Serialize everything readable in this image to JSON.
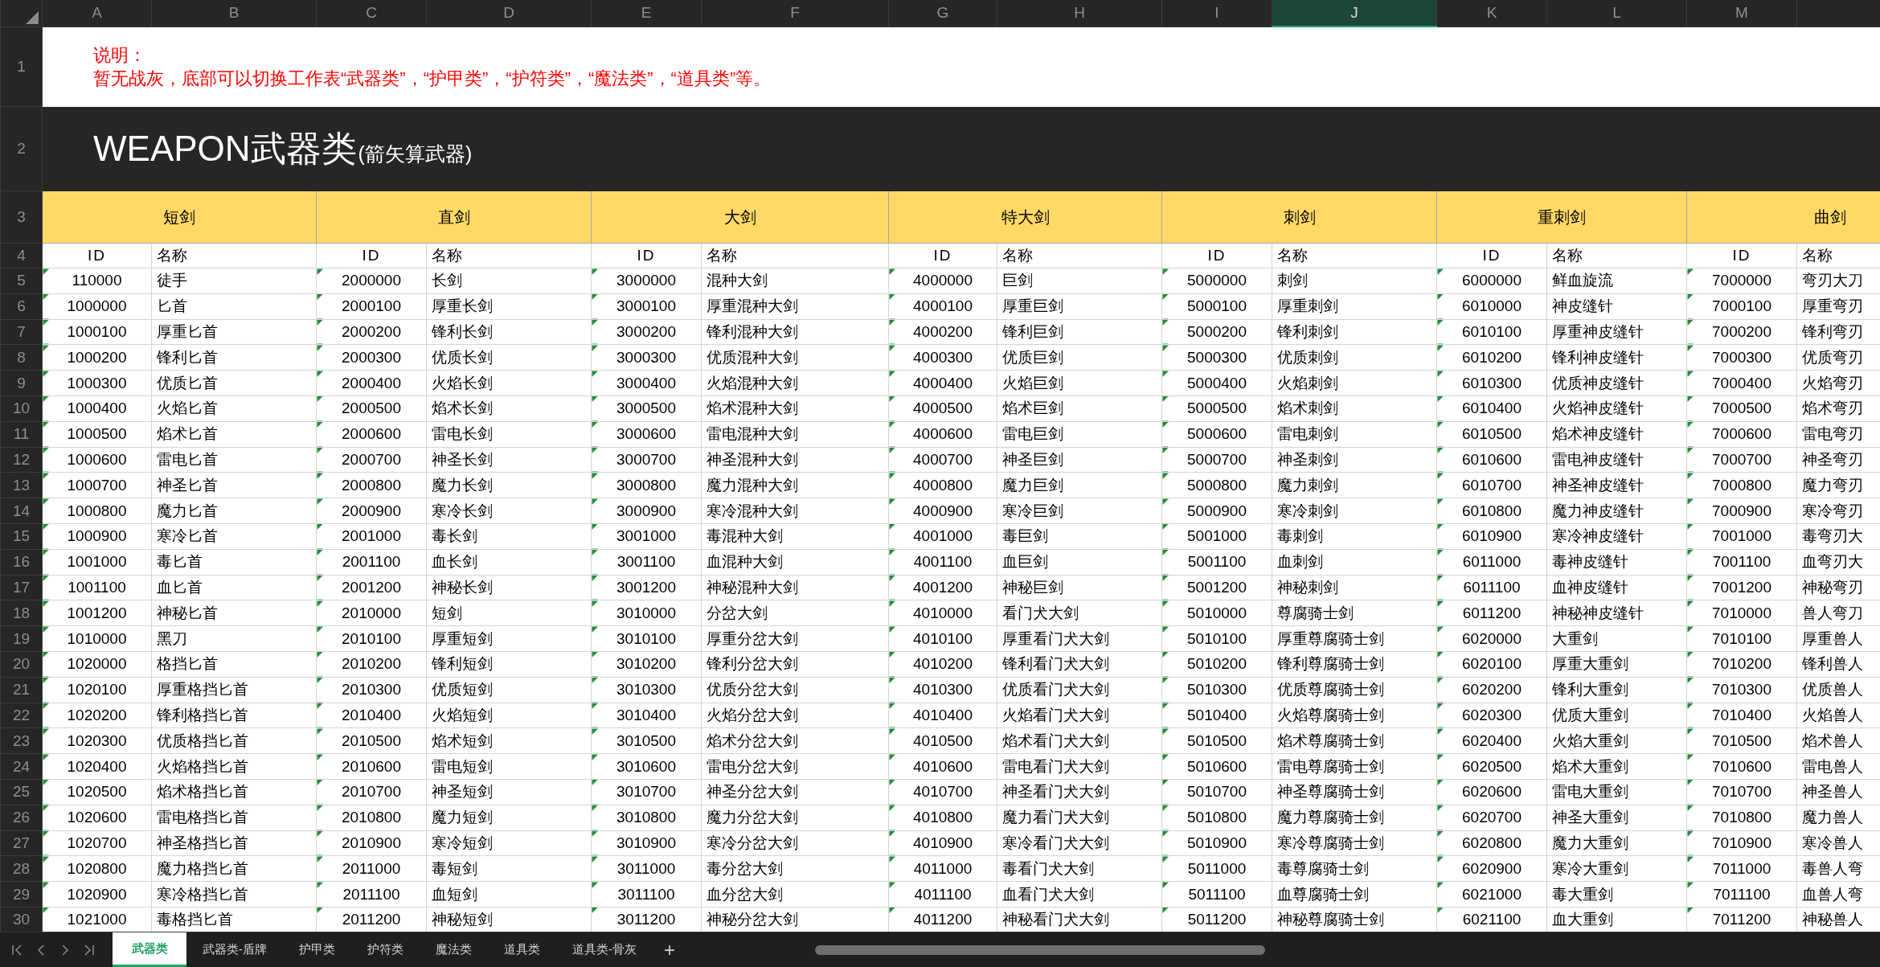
{
  "column_headers": [
    {
      "label": "A",
      "selected": false
    },
    {
      "label": "B",
      "selected": false
    },
    {
      "label": "C",
      "selected": false
    },
    {
      "label": "D",
      "selected": false
    },
    {
      "label": "E",
      "selected": false
    },
    {
      "label": "F",
      "selected": false
    },
    {
      "label": "G",
      "selected": false
    },
    {
      "label": "H",
      "selected": false
    },
    {
      "label": "I",
      "selected": false
    },
    {
      "label": "J",
      "selected": true
    },
    {
      "label": "K",
      "selected": false
    },
    {
      "label": "L",
      "selected": false
    },
    {
      "label": "M",
      "selected": false
    }
  ],
  "row_numbers": [
    "1",
    "2",
    "3",
    "4",
    "5",
    "6",
    "7",
    "8",
    "9",
    "10",
    "11",
    "12",
    "13",
    "14",
    "15",
    "16",
    "17",
    "18",
    "19",
    "20",
    "21",
    "22",
    "23",
    "24",
    "25",
    "26",
    "27",
    "28",
    "29",
    "30"
  ],
  "note": {
    "label": "说明：",
    "text": "暂无战灰，底部可以切换工作表“武器类”，“护甲类”，“护符类”，“魔法类”，“道具类”等。"
  },
  "title": {
    "main": "WEAPON武器类",
    "sub": "(箭矢算武器)"
  },
  "groups": [
    {
      "name": "短剑",
      "columns": [
        "ID",
        "名称"
      ],
      "flagged": true,
      "rows": [
        {
          "id": "110000",
          "name": "徒手"
        },
        {
          "id": "1000000",
          "name": "匕首"
        },
        {
          "id": "1000100",
          "name": "厚重匕首"
        },
        {
          "id": "1000200",
          "name": "锋利匕首"
        },
        {
          "id": "1000300",
          "name": "优质匕首"
        },
        {
          "id": "1000400",
          "name": "火焰匕首"
        },
        {
          "id": "1000500",
          "name": "焰术匕首"
        },
        {
          "id": "1000600",
          "name": "雷电匕首"
        },
        {
          "id": "1000700",
          "name": "神圣匕首"
        },
        {
          "id": "1000800",
          "name": "魔力匕首"
        },
        {
          "id": "1000900",
          "name": "寒冷匕首"
        },
        {
          "id": "1001000",
          "name": "毒匕首"
        },
        {
          "id": "1001100",
          "name": "血匕首"
        },
        {
          "id": "1001200",
          "name": "神秘匕首"
        },
        {
          "id": "1010000",
          "name": "黑刀"
        },
        {
          "id": "1020000",
          "name": "格挡匕首"
        },
        {
          "id": "1020100",
          "name": "厚重格挡匕首"
        },
        {
          "id": "1020200",
          "name": "锋利格挡匕首"
        },
        {
          "id": "1020300",
          "name": "优质格挡匕首"
        },
        {
          "id": "1020400",
          "name": "火焰格挡匕首"
        },
        {
          "id": "1020500",
          "name": "焰术格挡匕首"
        },
        {
          "id": "1020600",
          "name": "雷电格挡匕首"
        },
        {
          "id": "1020700",
          "name": "神圣格挡匕首"
        },
        {
          "id": "1020800",
          "name": "魔力格挡匕首"
        },
        {
          "id": "1020900",
          "name": "寒冷格挡匕首"
        },
        {
          "id": "1021000",
          "name": "毒格挡匕首"
        }
      ]
    },
    {
      "name": "直剑",
      "columns": [
        "ID",
        "名称"
      ],
      "flagged": true,
      "rows": [
        {
          "id": "2000000",
          "name": "长剑"
        },
        {
          "id": "2000100",
          "name": "厚重长剑"
        },
        {
          "id": "2000200",
          "name": "锋利长剑"
        },
        {
          "id": "2000300",
          "name": "优质长剑"
        },
        {
          "id": "2000400",
          "name": "火焰长剑"
        },
        {
          "id": "2000500",
          "name": "焰术长剑"
        },
        {
          "id": "2000600",
          "name": "雷电长剑"
        },
        {
          "id": "2000700",
          "name": "神圣长剑"
        },
        {
          "id": "2000800",
          "name": "魔力长剑"
        },
        {
          "id": "2000900",
          "name": "寒冷长剑"
        },
        {
          "id": "2001000",
          "name": "毒长剑"
        },
        {
          "id": "2001100",
          "name": "血长剑"
        },
        {
          "id": "2001200",
          "name": "神秘长剑"
        },
        {
          "id": "2010000",
          "name": "短剑"
        },
        {
          "id": "2010100",
          "name": "厚重短剑"
        },
        {
          "id": "2010200",
          "name": "锋利短剑"
        },
        {
          "id": "2010300",
          "name": "优质短剑"
        },
        {
          "id": "2010400",
          "name": "火焰短剑"
        },
        {
          "id": "2010500",
          "name": "焰术短剑"
        },
        {
          "id": "2010600",
          "name": "雷电短剑"
        },
        {
          "id": "2010700",
          "name": "神圣短剑"
        },
        {
          "id": "2010800",
          "name": "魔力短剑"
        },
        {
          "id": "2010900",
          "name": "寒冷短剑"
        },
        {
          "id": "2011000",
          "name": "毒短剑"
        },
        {
          "id": "2011100",
          "name": "血短剑"
        },
        {
          "id": "2011200",
          "name": "神秘短剑"
        }
      ]
    },
    {
      "name": "大剑",
      "columns": [
        "ID",
        "名称"
      ],
      "flagged": true,
      "rows": [
        {
          "id": "3000000",
          "name": "混种大剑"
        },
        {
          "id": "3000100",
          "name": "厚重混种大剑"
        },
        {
          "id": "3000200",
          "name": "锋利混种大剑"
        },
        {
          "id": "3000300",
          "name": "优质混种大剑"
        },
        {
          "id": "3000400",
          "name": "火焰混种大剑"
        },
        {
          "id": "3000500",
          "name": "焰术混种大剑"
        },
        {
          "id": "3000600",
          "name": "雷电混种大剑"
        },
        {
          "id": "3000700",
          "name": "神圣混种大剑"
        },
        {
          "id": "3000800",
          "name": "魔力混种大剑"
        },
        {
          "id": "3000900",
          "name": "寒冷混种大剑"
        },
        {
          "id": "3001000",
          "name": "毒混种大剑"
        },
        {
          "id": "3001100",
          "name": "血混种大剑"
        },
        {
          "id": "3001200",
          "name": "神秘混种大剑"
        },
        {
          "id": "3010000",
          "name": "分岔大剑"
        },
        {
          "id": "3010100",
          "name": "厚重分岔大剑"
        },
        {
          "id": "3010200",
          "name": "锋利分岔大剑"
        },
        {
          "id": "3010300",
          "name": "优质分岔大剑"
        },
        {
          "id": "3010400",
          "name": "火焰分岔大剑"
        },
        {
          "id": "3010500",
          "name": "焰术分岔大剑"
        },
        {
          "id": "3010600",
          "name": "雷电分岔大剑"
        },
        {
          "id": "3010700",
          "name": "神圣分岔大剑"
        },
        {
          "id": "3010800",
          "name": "魔力分岔大剑"
        },
        {
          "id": "3010900",
          "name": "寒冷分岔大剑"
        },
        {
          "id": "3011000",
          "name": "毒分岔大剑"
        },
        {
          "id": "3011100",
          "name": "血分岔大剑"
        },
        {
          "id": "3011200",
          "name": "神秘分岔大剑"
        }
      ]
    },
    {
      "name": "特大剑",
      "columns": [
        "ID",
        "名称"
      ],
      "flagged": true,
      "rows": [
        {
          "id": "4000000",
          "name": "巨剑"
        },
        {
          "id": "4000100",
          "name": "厚重巨剑"
        },
        {
          "id": "4000200",
          "name": "锋利巨剑"
        },
        {
          "id": "4000300",
          "name": "优质巨剑"
        },
        {
          "id": "4000400",
          "name": "火焰巨剑"
        },
        {
          "id": "4000500",
          "name": "焰术巨剑"
        },
        {
          "id": "4000600",
          "name": "雷电巨剑"
        },
        {
          "id": "4000700",
          "name": "神圣巨剑"
        },
        {
          "id": "4000800",
          "name": "魔力巨剑"
        },
        {
          "id": "4000900",
          "name": "寒冷巨剑"
        },
        {
          "id": "4001000",
          "name": "毒巨剑"
        },
        {
          "id": "4001100",
          "name": "血巨剑"
        },
        {
          "id": "4001200",
          "name": "神秘巨剑"
        },
        {
          "id": "4010000",
          "name": "看门犬大剑"
        },
        {
          "id": "4010100",
          "name": "厚重看门犬大剑"
        },
        {
          "id": "4010200",
          "name": "锋利看门犬大剑"
        },
        {
          "id": "4010300",
          "name": "优质看门犬大剑"
        },
        {
          "id": "4010400",
          "name": "火焰看门犬大剑"
        },
        {
          "id": "4010500",
          "name": "焰术看门犬大剑"
        },
        {
          "id": "4010600",
          "name": "雷电看门犬大剑"
        },
        {
          "id": "4010700",
          "name": "神圣看门犬大剑"
        },
        {
          "id": "4010800",
          "name": "魔力看门犬大剑"
        },
        {
          "id": "4010900",
          "name": "寒冷看门犬大剑"
        },
        {
          "id": "4011000",
          "name": "毒看门犬大剑"
        },
        {
          "id": "4011100",
          "name": "血看门犬大剑"
        },
        {
          "id": "4011200",
          "name": "神秘看门犬大剑"
        }
      ]
    },
    {
      "name": "刺剑",
      "columns": [
        "ID",
        "名称"
      ],
      "flagged": true,
      "rows": [
        {
          "id": "5000000",
          "name": "刺剑"
        },
        {
          "id": "5000100",
          "name": "厚重刺剑"
        },
        {
          "id": "5000200",
          "name": "锋利刺剑"
        },
        {
          "id": "5000300",
          "name": "优质刺剑"
        },
        {
          "id": "5000400",
          "name": "火焰刺剑"
        },
        {
          "id": "5000500",
          "name": "焰术刺剑"
        },
        {
          "id": "5000600",
          "name": "雷电刺剑"
        },
        {
          "id": "5000700",
          "name": "神圣刺剑"
        },
        {
          "id": "5000800",
          "name": "魔力刺剑"
        },
        {
          "id": "5000900",
          "name": "寒冷刺剑"
        },
        {
          "id": "5001000",
          "name": "毒刺剑"
        },
        {
          "id": "5001100",
          "name": "血刺剑"
        },
        {
          "id": "5001200",
          "name": "神秘刺剑"
        },
        {
          "id": "5010000",
          "name": "尊腐骑士剑"
        },
        {
          "id": "5010100",
          "name": "厚重尊腐骑士剑"
        },
        {
          "id": "5010200",
          "name": "锋利尊腐骑士剑"
        },
        {
          "id": "5010300",
          "name": "优质尊腐骑士剑"
        },
        {
          "id": "5010400",
          "name": "火焰尊腐骑士剑"
        },
        {
          "id": "5010500",
          "name": "焰术尊腐骑士剑"
        },
        {
          "id": "5010600",
          "name": "雷电尊腐骑士剑"
        },
        {
          "id": "5010700",
          "name": "神圣尊腐骑士剑"
        },
        {
          "id": "5010800",
          "name": "魔力尊腐骑士剑"
        },
        {
          "id": "5010900",
          "name": "寒冷尊腐骑士剑"
        },
        {
          "id": "5011000",
          "name": "毒尊腐骑士剑"
        },
        {
          "id": "5011100",
          "name": "血尊腐骑士剑"
        },
        {
          "id": "5011200",
          "name": "神秘尊腐骑士剑"
        }
      ]
    },
    {
      "name": "重刺剑",
      "columns": [
        "ID",
        "名称"
      ],
      "flagged": true,
      "rows": [
        {
          "id": "6000000",
          "name": "鲜血旋流"
        },
        {
          "id": "6010000",
          "name": "神皮缝针"
        },
        {
          "id": "6010100",
          "name": "厚重神皮缝针"
        },
        {
          "id": "6010200",
          "name": "锋利神皮缝针"
        },
        {
          "id": "6010300",
          "name": "优质神皮缝针"
        },
        {
          "id": "6010400",
          "name": "火焰神皮缝针"
        },
        {
          "id": "6010500",
          "name": "焰术神皮缝针"
        },
        {
          "id": "6010600",
          "name": "雷电神皮缝针"
        },
        {
          "id": "6010700",
          "name": "神圣神皮缝针"
        },
        {
          "id": "6010800",
          "name": "魔力神皮缝针"
        },
        {
          "id": "6010900",
          "name": "寒冷神皮缝针"
        },
        {
          "id": "6011000",
          "name": "毒神皮缝针"
        },
        {
          "id": "6011100",
          "name": "血神皮缝针"
        },
        {
          "id": "6011200",
          "name": "神秘神皮缝针"
        },
        {
          "id": "6020000",
          "name": "大重剑"
        },
        {
          "id": "6020100",
          "name": "厚重大重剑"
        },
        {
          "id": "6020200",
          "name": "锋利大重剑"
        },
        {
          "id": "6020300",
          "name": "优质大重剑"
        },
        {
          "id": "6020400",
          "name": "火焰大重剑"
        },
        {
          "id": "6020500",
          "name": "焰术大重剑"
        },
        {
          "id": "6020600",
          "name": "雷电大重剑"
        },
        {
          "id": "6020700",
          "name": "神圣大重剑"
        },
        {
          "id": "6020800",
          "name": "魔力大重剑"
        },
        {
          "id": "6020900",
          "name": "寒冷大重剑"
        },
        {
          "id": "6021000",
          "name": "毒大重剑"
        },
        {
          "id": "6021100",
          "name": "血大重剑"
        }
      ]
    },
    {
      "name": "曲剑",
      "columns": [
        "ID",
        "名称"
      ],
      "flagged": true,
      "rows": [
        {
          "id": "7000000",
          "name": "弯刃大刀"
        },
        {
          "id": "7000100",
          "name": "厚重弯刃"
        },
        {
          "id": "7000200",
          "name": "锋利弯刃"
        },
        {
          "id": "7000300",
          "name": "优质弯刃"
        },
        {
          "id": "7000400",
          "name": "火焰弯刃"
        },
        {
          "id": "7000500",
          "name": "焰术弯刃"
        },
        {
          "id": "7000600",
          "name": "雷电弯刃"
        },
        {
          "id": "7000700",
          "name": "神圣弯刃"
        },
        {
          "id": "7000800",
          "name": "魔力弯刃"
        },
        {
          "id": "7000900",
          "name": "寒冷弯刃"
        },
        {
          "id": "7001000",
          "name": "毒弯刃大"
        },
        {
          "id": "7001100",
          "name": "血弯刃大"
        },
        {
          "id": "7001200",
          "name": "神秘弯刃"
        },
        {
          "id": "7010000",
          "name": "兽人弯刀"
        },
        {
          "id": "7010100",
          "name": "厚重兽人"
        },
        {
          "id": "7010200",
          "name": "锋利兽人"
        },
        {
          "id": "7010300",
          "name": "优质兽人"
        },
        {
          "id": "7010400",
          "name": "火焰兽人"
        },
        {
          "id": "7010500",
          "name": "焰术兽人"
        },
        {
          "id": "7010600",
          "name": "雷电兽人"
        },
        {
          "id": "7010700",
          "name": "神圣兽人"
        },
        {
          "id": "7010800",
          "name": "魔力兽人"
        },
        {
          "id": "7010900",
          "name": "寒冷兽人"
        },
        {
          "id": "7011000",
          "name": "毒兽人弯"
        },
        {
          "id": "7011100",
          "name": "血兽人弯"
        },
        {
          "id": "7011200",
          "name": "神秘兽人"
        }
      ]
    }
  ],
  "sheet_tabs": [
    {
      "label": "武器类",
      "selected": true
    },
    {
      "label": "武器类-盾牌",
      "selected": false
    },
    {
      "label": "护甲类",
      "selected": false
    },
    {
      "label": "护符类",
      "selected": false
    },
    {
      "label": "魔法类",
      "selected": false
    },
    {
      "label": "道具类",
      "selected": false
    },
    {
      "label": "道具类-骨灰",
      "selected": false
    }
  ],
  "add_sheet": "+"
}
